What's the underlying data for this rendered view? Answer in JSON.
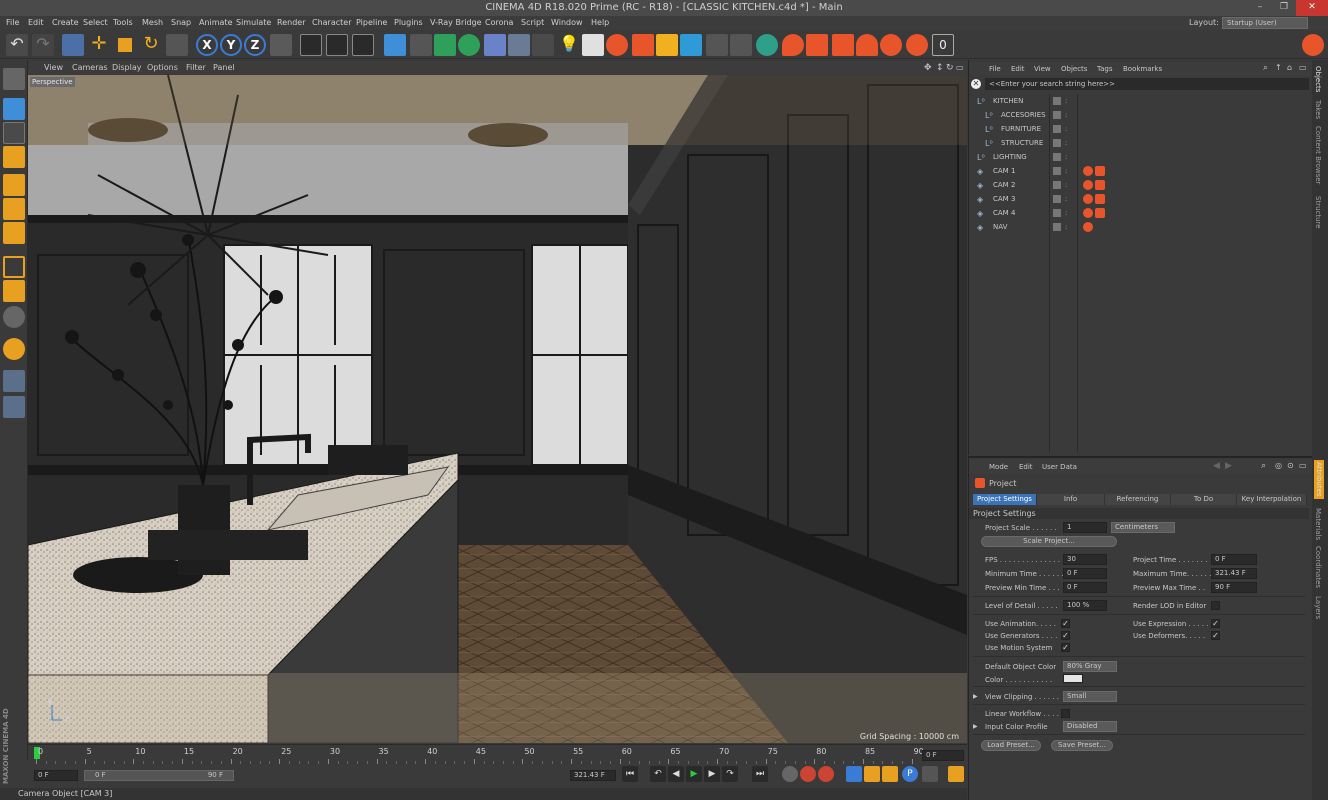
{
  "window": {
    "title": "CINEMA 4D R18.020 Prime (RC - R18) - [CLASSIC KITCHEN.c4d *] - Main",
    "controls": [
      "–",
      "❐",
      "✕"
    ]
  },
  "menubar": {
    "items": [
      "File",
      "Edit",
      "Create",
      "Select",
      "Tools",
      "Mesh",
      "Snap",
      "Animate",
      "Simulate",
      "Render",
      "Character",
      "Pipeline",
      "Plugins",
      "V-Ray Bridge",
      "Corona",
      "Script",
      "Window",
      "Help"
    ],
    "layout_label": "Layout:",
    "layout_value": "Startup (User)"
  },
  "viewport": {
    "menu": [
      "View",
      "Cameras",
      "Display",
      "Options",
      "Filter",
      "Panel"
    ],
    "label": "Perspective",
    "grid_spacing": "Grid Spacing : 10000 cm",
    "axis_y": "y",
    "axis_z": "z"
  },
  "timeline": {
    "ticks": [
      "0",
      "5",
      "10",
      "15",
      "20",
      "25",
      "30",
      "35",
      "40",
      "45",
      "50",
      "55",
      "60",
      "65",
      "70",
      "75",
      "80",
      "85",
      "90"
    ],
    "current_frame": "0 F"
  },
  "transport": {
    "start_field": "0 F",
    "range_start": "0 F",
    "range_end": "90 F",
    "end_field": "321.43 F"
  },
  "status": {
    "text": "Camera Object [CAM 3]",
    "brand": "MAXON CINEMA 4D"
  },
  "objects_panel": {
    "menu": [
      "File",
      "Edit",
      "View",
      "Objects",
      "Tags",
      "Bookmarks"
    ],
    "search_placeholder": "<<Enter your search string here>>",
    "rows": [
      {
        "name": "KITCHEN",
        "indent": 0,
        "tags": 0
      },
      {
        "name": "ACCESORIES",
        "indent": 1,
        "tags": 0
      },
      {
        "name": "FURNITURE",
        "indent": 1,
        "tags": 0
      },
      {
        "name": "STRUCTURE",
        "indent": 1,
        "tags": 0
      },
      {
        "name": "LIGHTING",
        "indent": 0,
        "tags": 0
      },
      {
        "name": "CAM 1",
        "indent": 0,
        "tags": 2
      },
      {
        "name": "CAM 2",
        "indent": 0,
        "tags": 2
      },
      {
        "name": "CAM 3",
        "indent": 0,
        "tags": 2
      },
      {
        "name": "CAM 4",
        "indent": 0,
        "tags": 2
      },
      {
        "name": "NAV",
        "indent": 0,
        "tags": 1
      }
    ]
  },
  "attributes_panel": {
    "menu": [
      "Mode",
      "Edit",
      "User Data"
    ],
    "object_label": "Project",
    "tabs": [
      "Project Settings",
      "Info",
      "Referencing",
      "To Do",
      "Key Interpolation"
    ],
    "section": "Project Settings",
    "project_scale_label": "Project Scale . . . . . .",
    "project_scale_value": "1",
    "project_scale_unit": "Centimeters",
    "scale_button": "Scale Project...",
    "fps_label": "FPS . . . . . . . . . . . . . .",
    "fps_value": "30",
    "project_time_label": "Project Time . . . . . . .",
    "project_time_value": "0 F",
    "min_time_label": "Minimum Time . . . . . .",
    "min_time_value": "0 F",
    "max_time_label": "Maximum Time. . . . . .",
    "max_time_value": "321.43 F",
    "pmin_label": "Preview Min Time . . .",
    "pmin_value": "0 F",
    "pmax_label": "Preview Max Time . .",
    "pmax_value": "90 F",
    "lod_label": "Level of Detail . . . . .",
    "lod_value": "100 %",
    "render_lod_label": "Render LOD in Editor",
    "use_anim_label": "Use Animation. . . . .",
    "use_expr_label": "Use Expression . . . . .",
    "use_gen_label": "Use Generators . . . .",
    "use_def_label": "Use Deformers. . . . .",
    "use_motion_label": "Use Motion System",
    "def_color_label": "Default Object Color",
    "def_color_value": "80% Gray",
    "color_label": "Color . . . . . . . . . . .",
    "view_clip_label": "View Clipping . . . . . .",
    "view_clip_value": "Small",
    "linear_label": "Linear Workflow . . . .",
    "icp_label": "Input Color Profile",
    "icp_value": "Disabled",
    "load_preset": "Load Preset...",
    "save_preset": "Save Preset...",
    "check_mark": "✓"
  },
  "side_tabs": {
    "top": [
      "Objects",
      "Takes",
      "Content Browser",
      "Structure"
    ],
    "bottom": [
      "Attributes",
      "Materials",
      "Coordinates",
      "Layers"
    ]
  },
  "colors": {
    "accent_blue": "#3a73b8",
    "orange": "#e8552b",
    "bg": "#3a3a3a"
  }
}
